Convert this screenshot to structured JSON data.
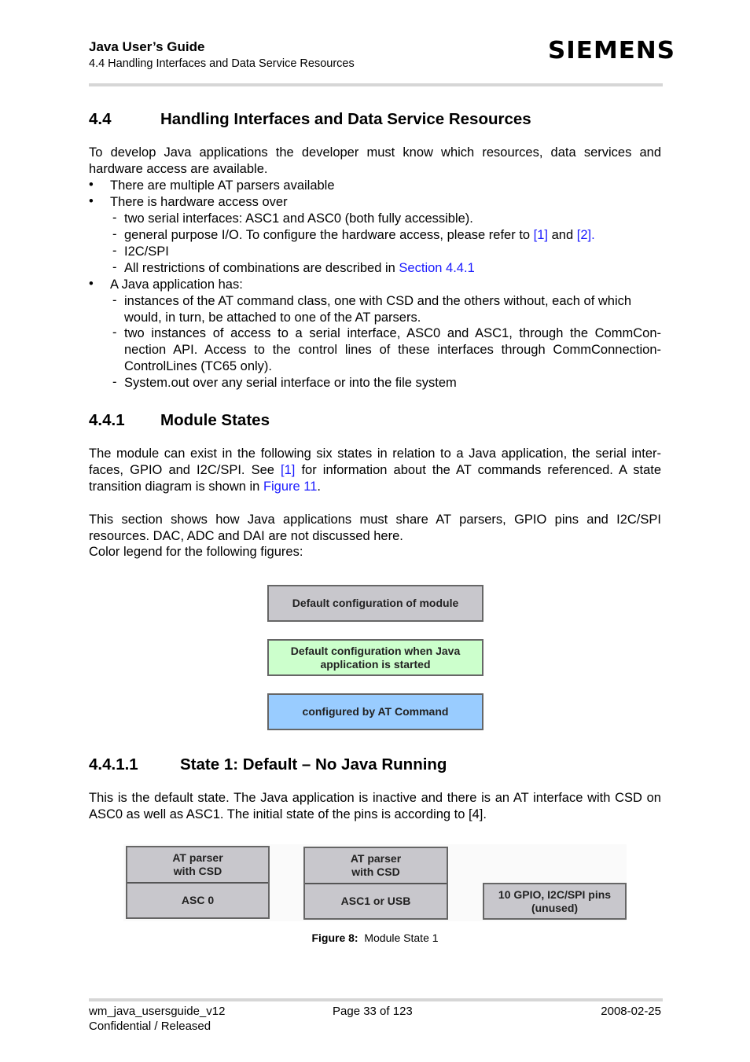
{
  "header": {
    "doc_title": "Java User’s Guide",
    "section_ref": "4.4 Handling Interfaces and Data Service Resources",
    "logo": "SIEMENS"
  },
  "section_4_4": {
    "number": "4.4",
    "title": "Handling Interfaces and Data Service Resources",
    "intro": "To develop Java applications the developer must know which resources, data services and hardware access are available.",
    "bullet1": "There are multiple AT parsers available",
    "bullet2": "There is hardware access over",
    "b2_sub1": "two serial interfaces: ASC1 and ASC0 (both fully accessible).",
    "b2_sub2_pre": "general purpose I/O. To configure the hardware access, please refer to ",
    "b2_sub2_link1": "[1]",
    "b2_sub2_mid": " and ",
    "b2_sub2_link2": "[2]",
    "b2_sub2_post": ".",
    "b2_sub3": "I2C/SPI",
    "b2_sub4_pre": "All restrictions of combinations are described in ",
    "b2_sub4_link": "Section 4.4.1",
    "bullet3": "A Java application has:",
    "b3_sub1_l1": "instances of the AT command class, one with CSD and the others without, each of which",
    "b3_sub1_l2": "would, in turn, be attached to one of the AT parsers.",
    "b3_sub2_l1": "two instances of access to a serial interface, ASC0 and ASC1, through the CommCon-",
    "b3_sub2_l2": "nection API. Access to the control lines of these interfaces through CommConnection-",
    "b3_sub2_l3": "ControlLines (TC65 only).",
    "b3_sub3": "System.out over any serial interface or into the file system",
    "bullet_glyph": "•",
    "dash_glyph": "-"
  },
  "section_4_4_1": {
    "number": "4.4.1",
    "title": "Module States",
    "p1_pre": "The module can exist in the following six states in relation to a Java application, the serial inter-faces, GPIO and I2C/SPI. See ",
    "p1_link1": "[1]",
    "p1_mid": " for information about the AT commands referenced. A state transition diagram is shown in ",
    "p1_link2": "Figure 11",
    "p1_post": ".",
    "p2": "This section shows how Java applications must share AT parsers, GPIO pins and I2C/SPI resources. DAC, ADC and DAI are not discussed here.",
    "p3": "Color legend for the following figures:"
  },
  "legend": [
    {
      "label": "Default configuration of module",
      "color": "#c8c7cc"
    },
    {
      "label": "Default configuration when Java application is started",
      "color": "#ccffcc"
    },
    {
      "label": "configured by AT Command",
      "color": "#99ccff"
    }
  ],
  "section_4_4_1_1": {
    "number": "4.4.1.1",
    "title": "State 1: Default – No Java Running",
    "p1": "This is the default state. The Java application is inactive and there is an AT interface with CSD on ASC0 as well as ASC1. The initial state of the pins is according to [4]."
  },
  "figure8": {
    "box1_top": "AT parser\nwith CSD",
    "box1_bottom": "ASC 0",
    "box2_top": "AT parser\nwith CSD",
    "box2_bottom": "ASC1 or USB",
    "box3": "10 GPIO, I2C/SPI  pins\n(unused)",
    "caption_label": "Figure 8:",
    "caption_text": "Module State 1"
  },
  "footer": {
    "doc_id": "wm_java_usersguide_v12",
    "status": "Confidential / Released",
    "page": "Page 33 of 123",
    "date": "2008-02-25"
  }
}
